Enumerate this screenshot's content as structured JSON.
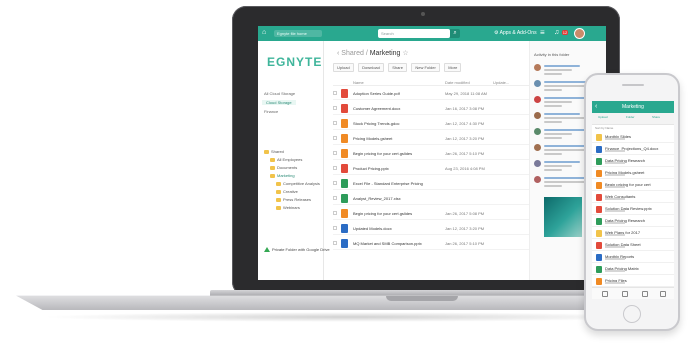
{
  "laptop": {
    "top_bar": {
      "path_label": "Egnyte file home",
      "search_placeholder": "Search",
      "search_icon": "search-icon",
      "apps_label": "Apps & Add-Ons",
      "menu_icon": "hamburger-icon",
      "notifications_icon": "bell-icon",
      "notification_count": "12",
      "brand_color": "#29a88f"
    },
    "sidebar": {
      "logo": "EGNYTE",
      "storage_items": [
        "All Cloud Storage",
        "Cloud Storage",
        "Finance"
      ],
      "tree": [
        {
          "label": "Shared",
          "level": 0
        },
        {
          "label": "All Employees",
          "level": 1
        },
        {
          "label": "Documents",
          "level": 1
        },
        {
          "label": "Marketing",
          "level": 1
        },
        {
          "label": "Competitive Analysis",
          "level": 2
        },
        {
          "label": "Creative",
          "level": 2
        },
        {
          "label": "Press Releases",
          "level": 2
        },
        {
          "label": "Webinars",
          "level": 2
        }
      ],
      "gdrive_label": "Private Folder with Google Drive"
    },
    "main": {
      "breadcrumb_parent": "Shared",
      "breadcrumb_current": "Marketing",
      "toolbar": [
        "Upload",
        "Download",
        "Share",
        "New Folder",
        "More"
      ],
      "columns": {
        "name": "Name",
        "date": "Date modified",
        "update": "Update..."
      },
      "files": [
        {
          "name": "Adoption Series Guide.pdf",
          "date": "May 29, 2018 11:08 AM",
          "color": "#e24a3b"
        },
        {
          "name": "Customer Agreement.docx",
          "date": "Jan 16, 2017 3:08 PM",
          "color": "#e24a3b"
        },
        {
          "name": "Stock Pricing Trends.gdoc",
          "date": "Jan 12, 2017 4:30 PM",
          "color": "#f08a24"
        },
        {
          "name": "Pricing Models.gsheet",
          "date": "Jan 12, 2017 3:20 PM",
          "color": "#f08a24"
        },
        {
          "name": "Begin pricing for your cert.gslides",
          "date": "Jan 26, 2017 5:10 PM",
          "color": "#f08a24"
        },
        {
          "name": "Product Pricing.pptx",
          "date": "Aug 23, 2016 4:08 PM",
          "color": "#e24a3b"
        },
        {
          "name": "Excel File - Standard Enterprise Pricing",
          "date": "",
          "color": "#2e9c5a"
        },
        {
          "name": "Analyst_Review_2017.xlsx",
          "date": "",
          "color": "#2e9c5a"
        },
        {
          "name": "Begin pricing for your cert.gslides",
          "date": "Jan 26, 2017 5:08 PM",
          "color": "#f08a24"
        },
        {
          "name": "Updated Models.docx",
          "date": "Jan 12, 2017 3:20 PM",
          "color": "#2b6cc4"
        },
        {
          "name": "MQ Market and SMB Comparison.pptx",
          "date": "Jan 26, 2017 5:10 PM",
          "color": "#2b6cc4"
        }
      ]
    },
    "activity": {
      "heading": "Activity in this folder",
      "avatar_colors": [
        "#b57a5a",
        "#6a8fb0",
        "#c44",
        "#9a6a4a",
        "#5a8a6a",
        "#a07050",
        "#7a7a9a",
        "#b06060"
      ]
    }
  },
  "phone": {
    "title": "Marketing",
    "actions": [
      "Upload",
      "Folder",
      "Share"
    ],
    "sort_label": "Sort by Name",
    "files": [
      {
        "name": "Monthly Slides",
        "color": "#f1c34a"
      },
      {
        "name": "Finance_Projections_Q4.docx",
        "color": "#2b6cc4"
      },
      {
        "name": "Data Pricing Research",
        "color": "#2e9c5a"
      },
      {
        "name": "Pricing Models.gsheet",
        "color": "#f08a24"
      },
      {
        "name": "Begin pricing for your cert",
        "color": "#f08a24"
      },
      {
        "name": "Web Consultants",
        "color": "#e24a3b"
      },
      {
        "name": "Solution Data Review.pptx",
        "color": "#e24a3b"
      },
      {
        "name": "Data Pricing Research",
        "color": "#2e9c5a"
      },
      {
        "name": "Web Plans for 2017",
        "color": "#f1c34a"
      },
      {
        "name": "Solution Data Sheet",
        "color": "#e24a3b"
      },
      {
        "name": "Monthly Reports",
        "color": "#2b6cc4"
      },
      {
        "name": "Data Pricing Matrix",
        "color": "#2e9c5a"
      },
      {
        "name": "Pricing Files",
        "color": "#f08a24"
      }
    ]
  }
}
